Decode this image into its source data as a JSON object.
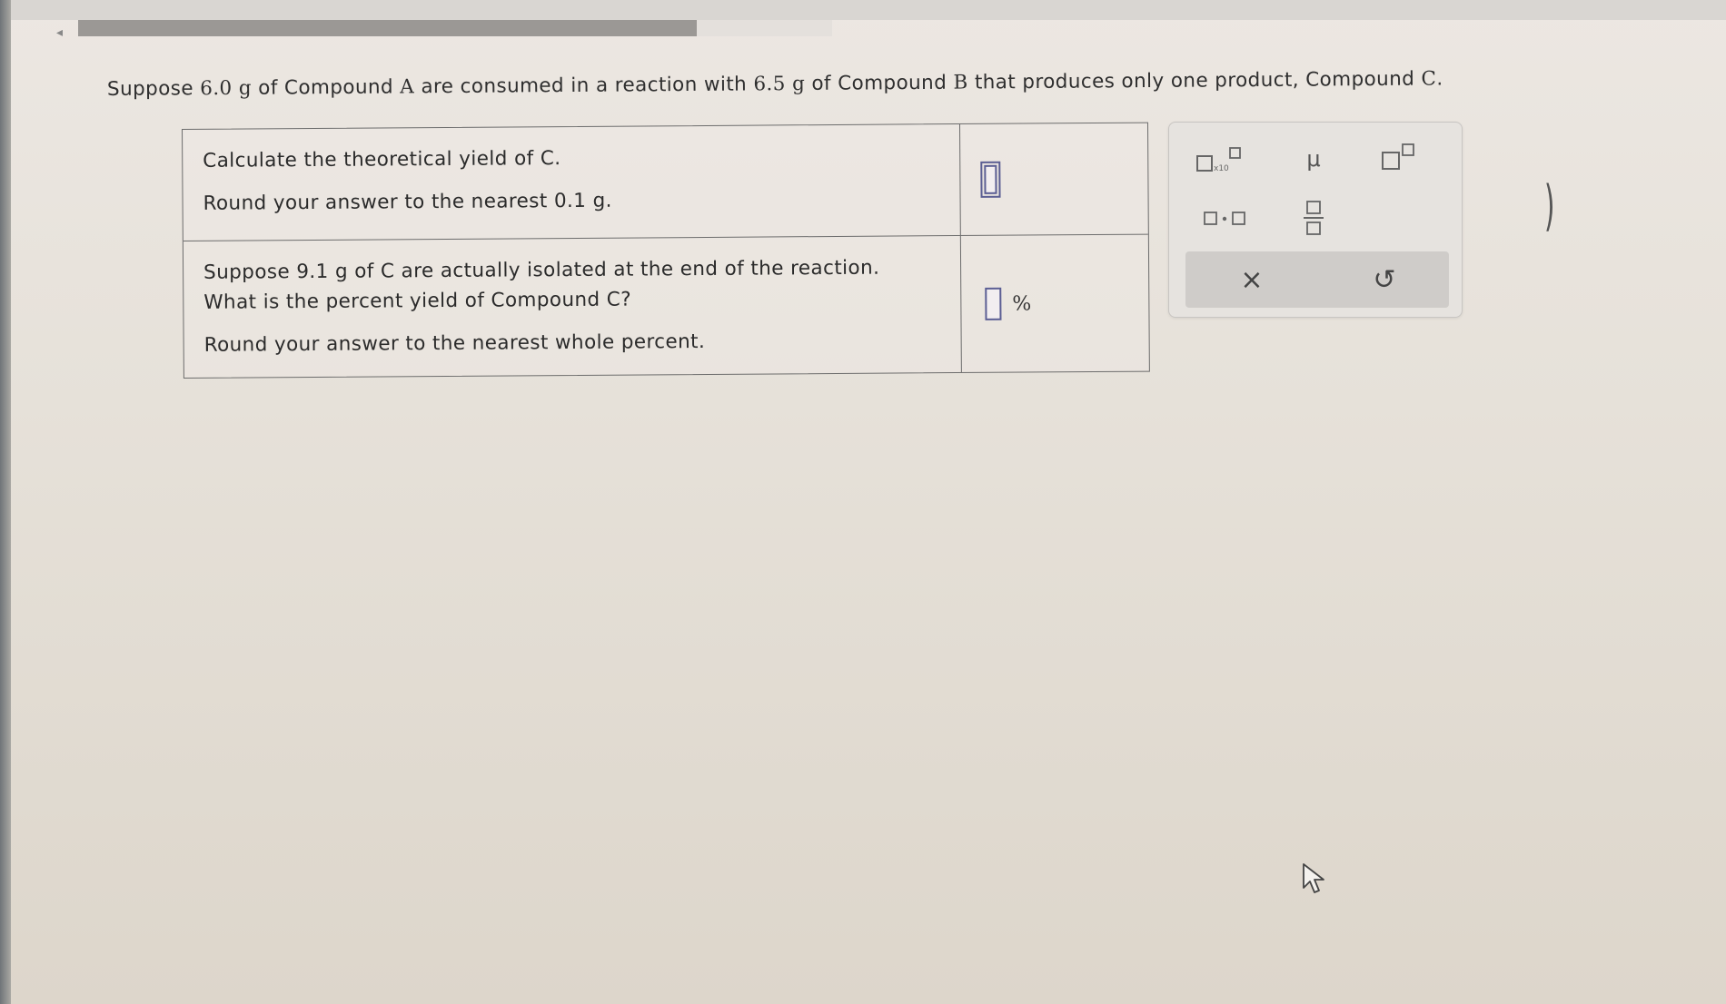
{
  "header": {
    "progress_fraction": 0.82
  },
  "question": {
    "intro_parts": [
      "Suppose ",
      "6.0",
      " g",
      " of Compound ",
      "A",
      " are consumed in a reaction with ",
      "6.5",
      " g",
      " of Compound ",
      "B",
      " that produces only one product, Compound ",
      "C",
      "."
    ]
  },
  "rows": [
    {
      "lines": [
        "Calculate the theoretical yield of C.",
        "Round your answer to the nearest 0.1 g."
      ],
      "answer_value": "",
      "unit": ""
    },
    {
      "lines": [
        "Suppose 9.1 g of C are actually isolated at the end of the reaction.",
        "What is the percent yield of Compound C?",
        "Round your answer to the nearest whole percent."
      ],
      "answer_value": "",
      "unit": "%"
    }
  ],
  "toolbox": {
    "x10_label": "x10",
    "mu_label": "μ",
    "clear_label": "×",
    "undo_label": "↺"
  },
  "icons": {
    "scientific_notation": "x10-power-icon",
    "micro": "mu-icon",
    "superscript": "superscript-icon",
    "multiply_dot": "multiply-dot-icon",
    "fraction": "fraction-icon",
    "clear": "clear-icon",
    "undo": "undo-icon"
  },
  "colors": {
    "answer_box_border": "#5b5e93",
    "table_border": "#6c6c6c"
  }
}
